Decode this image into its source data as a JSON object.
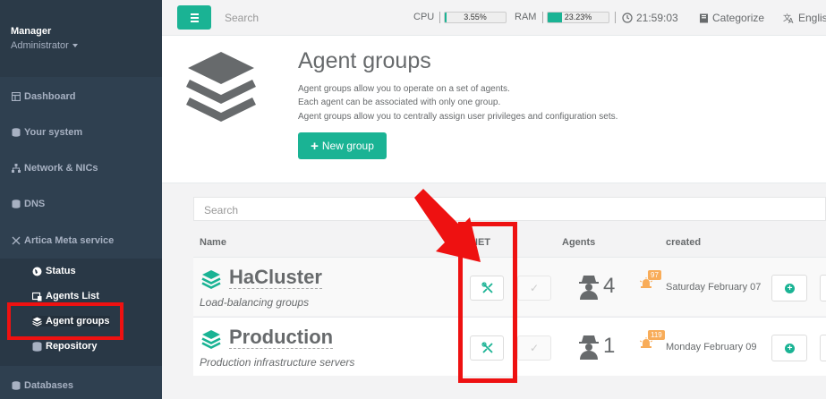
{
  "profile": {
    "name": "Manager",
    "role": "Administrator"
  },
  "sidebar": {
    "items": [
      {
        "label": "Dashboard",
        "icon": "dashboard-icon"
      },
      {
        "label": "Your system",
        "icon": "database-icon"
      },
      {
        "label": "Network & NICs",
        "icon": "network-icon"
      },
      {
        "label": "DNS",
        "icon": "database-icon"
      },
      {
        "label": "Artica Meta service",
        "icon": "meta-icon"
      }
    ],
    "subitems": [
      {
        "label": "Status",
        "icon": "globe-icon"
      },
      {
        "label": "Agents List",
        "icon": "server-icon"
      },
      {
        "label": "Agent groups",
        "icon": "stack-icon"
      },
      {
        "label": "Repository",
        "icon": "database-icon"
      }
    ],
    "bottom": {
      "label": "Databases",
      "icon": "database-icon"
    }
  },
  "topbar": {
    "search_placeholder": "Search",
    "cpu_label": "CPU",
    "cpu_value": "3.55%",
    "cpu_percent": 3.55,
    "ram_label": "RAM",
    "ram_value": "23.23%",
    "ram_percent": 23.23,
    "time": "21:59:03",
    "categorize": "Categorize",
    "language": "English"
  },
  "header": {
    "title": "Agent groups",
    "lines": [
      "Agent groups allow you to operate on a set of agents.",
      "Each agent can be associated with only one group.",
      "Agent groups allow you to centrally assign user privileges and configuration sets."
    ],
    "new_group": "New group"
  },
  "table": {
    "search_placeholder": "Search",
    "headers": {
      "name": "Name",
      "net": "NET",
      "agents": "Agents",
      "created": "created"
    },
    "rows": [
      {
        "name": "HaCluster",
        "description": "Load-balancing groups",
        "agents": "4",
        "alerts": "97",
        "created": "Saturday February 07"
      },
      {
        "name": "Production",
        "description": "Production infrastructure servers",
        "agents": "1",
        "alerts": "119",
        "created": "Monday February 09"
      }
    ]
  },
  "colors": {
    "accent": "#1ab394",
    "sidebar": "#2f4050",
    "annotation": "#ee1111",
    "badge": "#f8ac59"
  }
}
